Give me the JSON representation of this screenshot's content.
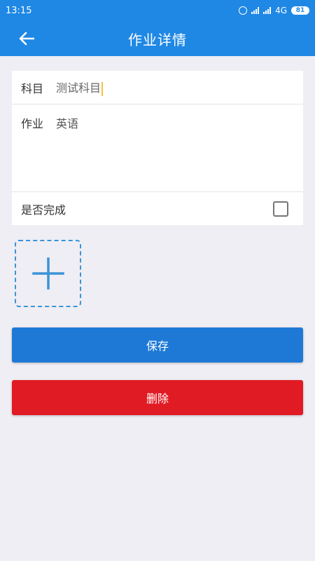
{
  "status_bar": {
    "time": "13:15",
    "network": "4G",
    "battery": "81"
  },
  "app_bar": {
    "title": "作业详情"
  },
  "form": {
    "subject": {
      "label": "科目",
      "value": "测试科目"
    },
    "homework": {
      "label": "作业",
      "value": "英语"
    },
    "completed": {
      "label": "是否完成",
      "checked": false
    }
  },
  "buttons": {
    "save_label": "保存",
    "delete_label": "删除"
  },
  "colors": {
    "primary": "#1f88e5",
    "save": "#1e79d6",
    "delete": "#e11b24",
    "background": "#efeef4",
    "add_photo_border": "#3a94d6"
  },
  "icons": {
    "back": "arrow-left-icon",
    "add": "plus-icon",
    "alarm": "alarm-icon",
    "signal": "signal-icon",
    "battery": "battery-icon"
  }
}
